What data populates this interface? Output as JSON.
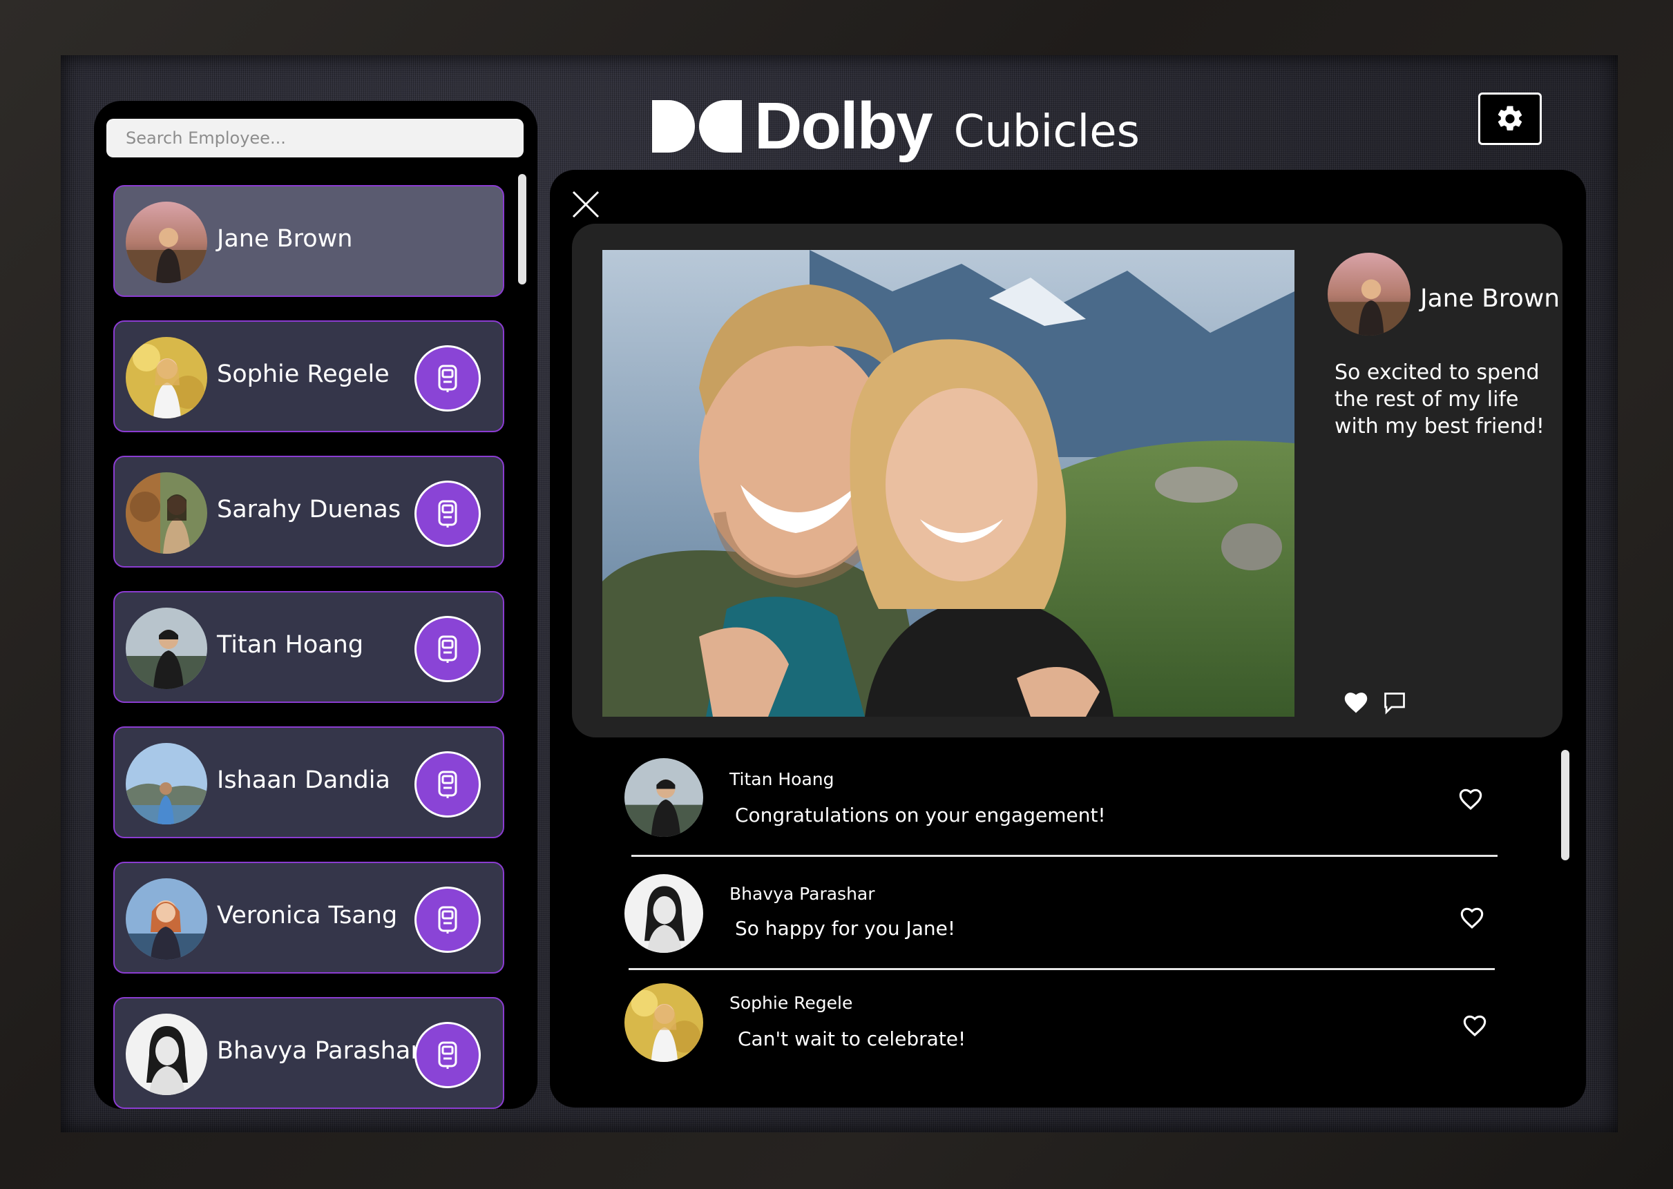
{
  "header": {
    "brand": "Dolby",
    "product": "Cubicles"
  },
  "settings": {
    "icon": "gear-icon"
  },
  "sidebar": {
    "search_placeholder": "Search Employee...",
    "employees": [
      {
        "name": "Jane Brown",
        "selected": true
      },
      {
        "name": "Sophie Regele"
      },
      {
        "name": "Sarahy Duenas"
      },
      {
        "name": "Titan Hoang"
      },
      {
        "name": "Ishaan Dandia"
      },
      {
        "name": "Veronica Tsang"
      },
      {
        "name": "Bhavya Parashar"
      }
    ]
  },
  "post": {
    "author": "Jane Brown",
    "caption": "So excited to spend the rest of my life with my best friend!"
  },
  "comments": [
    {
      "author": "Titan Hoang",
      "text": "Congratulations on your engagement!"
    },
    {
      "author": "Bhavya Parashar",
      "text": "So happy for you Jane!"
    },
    {
      "author": "Sophie Regele",
      "text": "Can't wait to celebrate!"
    }
  ],
  "colors": {
    "accent": "#8a44d6",
    "card": "#35364a",
    "card_selected": "#5a5b70",
    "panel": "#000000",
    "post_card": "#232323"
  }
}
